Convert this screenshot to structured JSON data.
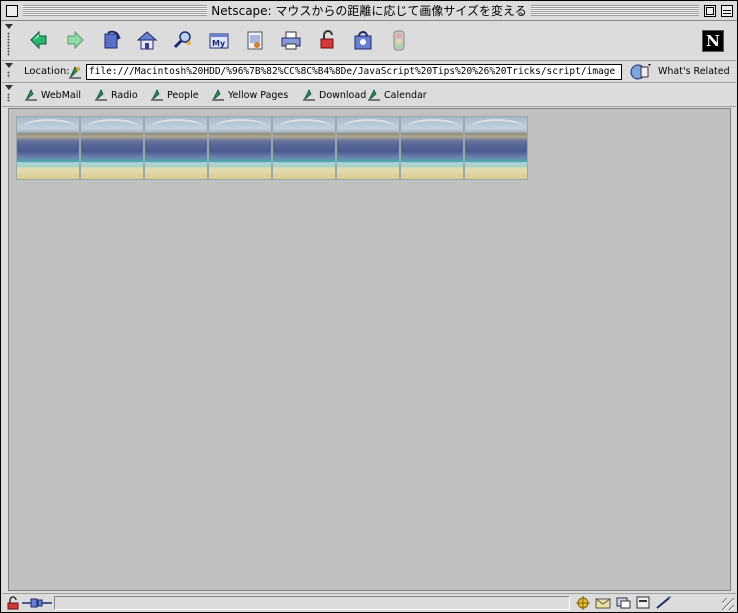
{
  "window": {
    "title": "Netscape: マウスからの距離に応じて画像サイズを変える"
  },
  "navigation_toolbar": {
    "buttons": [
      {
        "icon": "back-icon"
      },
      {
        "icon": "forward-icon"
      },
      {
        "icon": "reload-icon"
      },
      {
        "icon": "home-icon"
      },
      {
        "icon": "search-icon"
      },
      {
        "icon": "my-netscape-icon",
        "text": "My"
      },
      {
        "icon": "images-icon"
      },
      {
        "icon": "print-icon"
      },
      {
        "icon": "security-icon"
      },
      {
        "icon": "shop-icon"
      },
      {
        "icon": "stop-icon"
      }
    ],
    "logo_letter": "N"
  },
  "location_bar": {
    "label": "Location:",
    "url": "file:///Macintosh%20HDD/%96%7B%82%CC%8C%B4%8De/JavaScript%20Tips%20%26%20Tricks/script/image",
    "related_label": "What's Related"
  },
  "personal_toolbar": {
    "items": [
      {
        "label": "WebMail"
      },
      {
        "label": "Radio"
      },
      {
        "label": "People"
      },
      {
        "label": "Yellow Pages"
      },
      {
        "label": "Download"
      },
      {
        "label": "Calendar"
      }
    ]
  },
  "content": {
    "image_count": 8,
    "image_subject": "beach-landscape"
  },
  "status_bar": {
    "text": ""
  },
  "colors": {
    "chrome": "#dcdcdc",
    "content_bg": "#c0c0c0",
    "bookmark_green": "#2e8b57"
  }
}
